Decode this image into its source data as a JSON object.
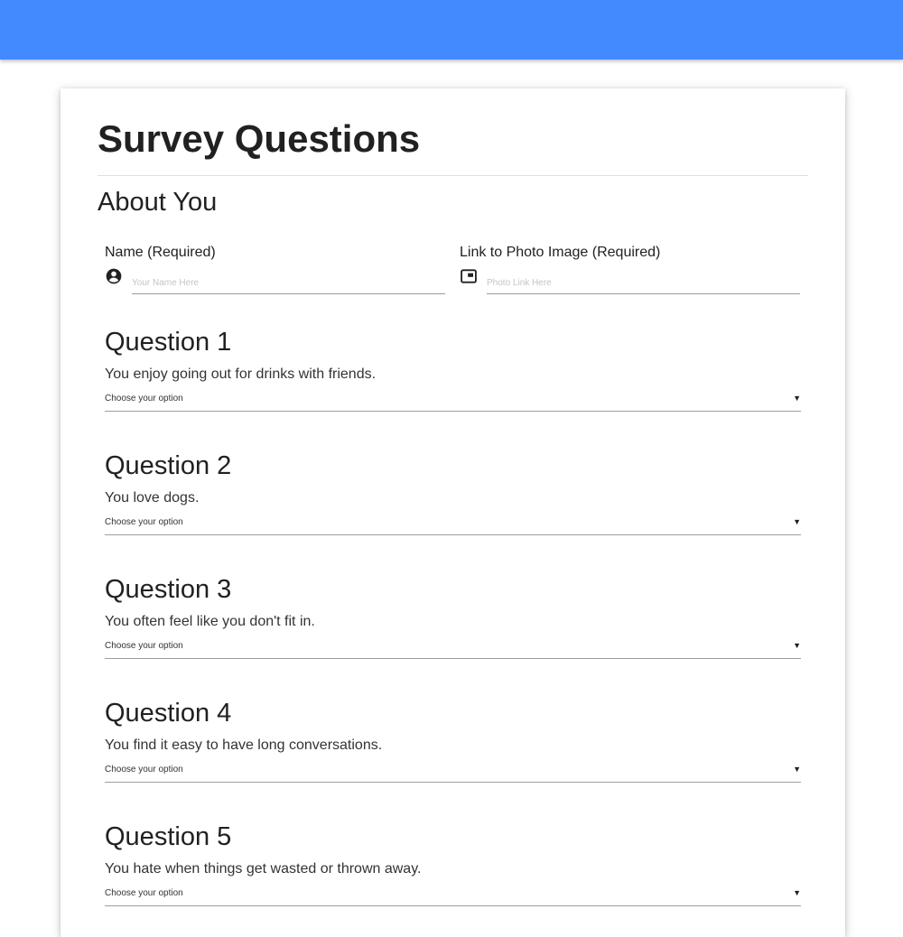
{
  "header": {
    "color": "#448aff"
  },
  "page": {
    "title": "Survey Questions",
    "section_title": "About You"
  },
  "fields": {
    "name": {
      "label": "Name (Required)",
      "placeholder": "Your Name Here",
      "icon": "account-circle-icon"
    },
    "photo": {
      "label": "Link to Photo Image (Required)",
      "placeholder": "Photo Link Here",
      "icon": "picture-in-picture-icon"
    }
  },
  "questions": [
    {
      "title": "Question 1",
      "text": "You enjoy going out for drinks with friends.",
      "selected": "Choose your option"
    },
    {
      "title": "Question 2",
      "text": "You love dogs.",
      "selected": "Choose your option"
    },
    {
      "title": "Question 3",
      "text": "You often feel like you don't fit in.",
      "selected": "Choose your option"
    },
    {
      "title": "Question 4",
      "text": "You find it easy to have long conversations.",
      "selected": "Choose your option"
    },
    {
      "title": "Question 5",
      "text": "You hate when things get wasted or thrown away.",
      "selected": "Choose your option"
    }
  ],
  "select_caret": "▼"
}
